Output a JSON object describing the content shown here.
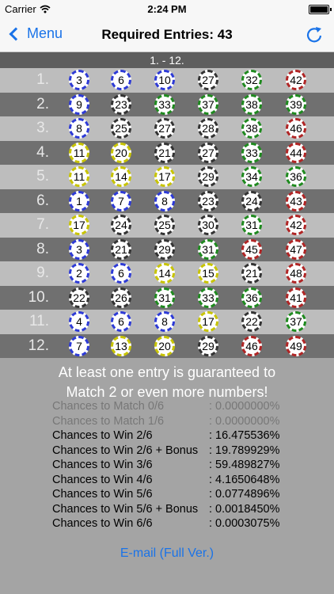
{
  "status": {
    "carrier": "Carrier",
    "time": "2:24 PM"
  },
  "nav": {
    "back_label": "Menu",
    "title": "Required Entries: 43"
  },
  "section": {
    "header": "1. - 12."
  },
  "rows": [
    {
      "label": "1.",
      "balls": [
        3,
        6,
        10,
        27,
        32,
        42
      ]
    },
    {
      "label": "2.",
      "balls": [
        9,
        23,
        33,
        37,
        38,
        39
      ]
    },
    {
      "label": "3.",
      "balls": [
        8,
        25,
        27,
        28,
        38,
        46
      ]
    },
    {
      "label": "4.",
      "balls": [
        11,
        20,
        21,
        27,
        33,
        44
      ]
    },
    {
      "label": "5.",
      "balls": [
        11,
        14,
        17,
        29,
        34,
        36
      ]
    },
    {
      "label": "6.",
      "balls": [
        1,
        7,
        8,
        23,
        24,
        43
      ]
    },
    {
      "label": "7.",
      "balls": [
        17,
        24,
        25,
        30,
        31,
        42
      ]
    },
    {
      "label": "8.",
      "balls": [
        3,
        21,
        29,
        31,
        45,
        47
      ]
    },
    {
      "label": "9.",
      "balls": [
        2,
        6,
        14,
        15,
        21,
        48
      ]
    },
    {
      "label": "10.",
      "balls": [
        22,
        26,
        31,
        33,
        36,
        41
      ]
    },
    {
      "label": "11.",
      "balls": [
        4,
        6,
        8,
        17,
        22,
        37
      ]
    },
    {
      "label": "12.",
      "balls": [
        7,
        13,
        20,
        29,
        46,
        49
      ]
    }
  ],
  "guarantee": {
    "line1": "At least one entry is guaranteed to",
    "line2": "Match 2 or even more numbers!"
  },
  "stats": [
    {
      "label": "Chances to Match 0/6",
      "value": ": 0.0000000%"
    },
    {
      "label": "Chances to Match 1/6",
      "value": ": 0.0000000%"
    },
    {
      "label": "Chances to Win 2/6",
      "value": ": 16.475536%"
    },
    {
      "label": "Chances to Win 2/6 + Bonus",
      "value": ": 19.789929%"
    },
    {
      "label": "Chances to Win 3/6",
      "value": ": 59.489827%"
    },
    {
      "label": "Chances to Win 4/6",
      "value": ": 4.1650648%"
    },
    {
      "label": "Chances to Win 5/6",
      "value": ": 0.0774896%"
    },
    {
      "label": "Chances to Win 5/6 + Bonus",
      "value": ": 0.0018450%"
    },
    {
      "label": "Chances to Win 6/6",
      "value": ": 0.0003075%"
    }
  ],
  "email": {
    "label": "E-mail (Full Ver.)"
  },
  "colors": {
    "accent": "#1a73e8",
    "ball_blue": "#2d3ad6",
    "ball_yellow": "#c8c400",
    "ball_black": "#333333",
    "ball_green": "#1f8a1f",
    "ball_red": "#b02525"
  }
}
